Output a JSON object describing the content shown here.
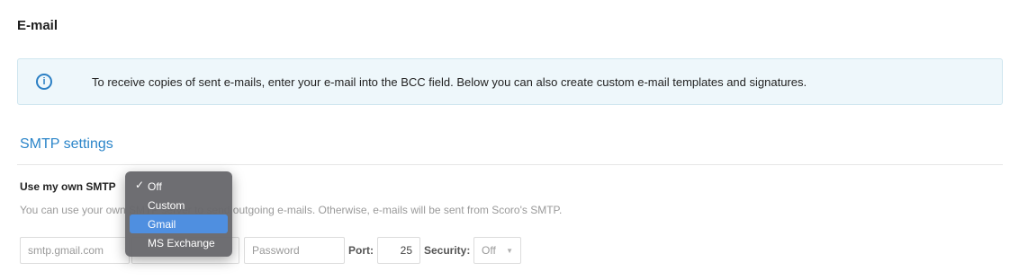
{
  "page": {
    "title": "E-mail"
  },
  "info": {
    "icon": "info-icon",
    "text": "To receive copies of sent e-mails, enter your e-mail into the BCC field. Below you can also create custom e-mail templates and signatures."
  },
  "smtp": {
    "section_title": "SMTP settings",
    "use_own_label": "Use my own SMTP",
    "hint": "You can use your own SMTP server to send outgoing e-mails. Otherwise, e-mails will be sent from Scoro's SMTP.",
    "dropdown": {
      "selected": "Off",
      "highlighted": "Gmail",
      "options": [
        "Off",
        "Custom",
        "Gmail",
        "MS Exchange"
      ]
    },
    "host_value": "smtp.gmail.com",
    "username_placeholder": "",
    "password_placeholder": "Password",
    "port_label": "Port:",
    "port_value": "25",
    "security_label": "Security:",
    "security_value": "Off"
  },
  "colors": {
    "accent": "#2b85c9",
    "info_bg": "#eef7fb",
    "menu_bg": "#68686c",
    "menu_highlight": "#4f8fe0"
  }
}
